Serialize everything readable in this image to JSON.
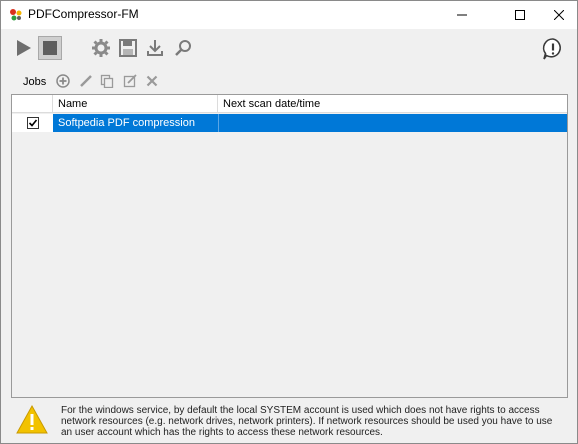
{
  "window": {
    "title": "PDFCompressor-FM"
  },
  "toolbar": {
    "buttons": [
      {
        "name": "start",
        "icon": "play-icon"
      },
      {
        "name": "stop",
        "icon": "stop-icon"
      },
      {
        "name": "settings",
        "icon": "gear-icon"
      },
      {
        "name": "save",
        "icon": "floppy-icon"
      },
      {
        "name": "import",
        "icon": "download-icon"
      },
      {
        "name": "search",
        "icon": "search-icon"
      }
    ],
    "info_icon": "info-icon"
  },
  "jobs": {
    "label": "Jobs",
    "actions": [
      "add-icon",
      "edit-icon",
      "copy-icon",
      "edit-doc-icon",
      "delete-icon"
    ]
  },
  "grid": {
    "columns": [
      "Name",
      "Next scan date/time"
    ],
    "rows": [
      {
        "checked": true,
        "name": "Softpedia PDF compression",
        "next_scan": "",
        "selected": true
      }
    ]
  },
  "footer": {
    "warning_text": "For the windows service, by default the local SYSTEM account is used which does not have rights to access network resources (e.g. network drives, network printers). If network resources should be used you have to use an user account which has the rights to access these network resources."
  },
  "colors": {
    "selection": "#0078d7",
    "warning": "#f2c200"
  }
}
